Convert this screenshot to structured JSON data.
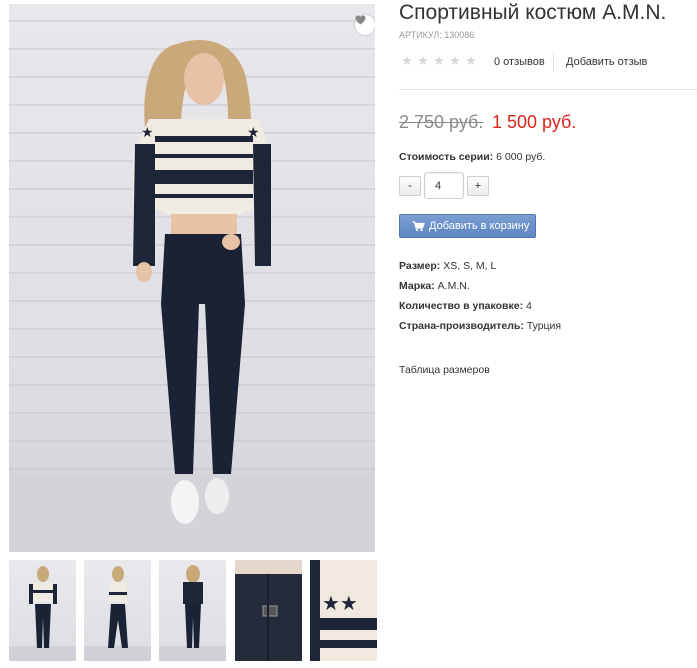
{
  "product": {
    "title": "Спортивный костюм A.M.N.",
    "article": "АРТИКУЛ: 130086",
    "rating_stars": 0,
    "reviews_count": "0 отзывов",
    "add_review": "Добавить отзыв",
    "old_price": "2 750 руб.",
    "new_price": "1 500 руб.",
    "series_cost_label": "Стоимость серии:",
    "series_cost_value": "6 000 руб.",
    "quantity_value": "4",
    "qty_minus": "-",
    "qty_plus": "+",
    "add_to_cart": "Добавить в корзину",
    "properties": [
      {
        "label": "Размер:",
        "value": "XS, S, M, L"
      },
      {
        "label": "Марка:",
        "value": "A.M.N."
      },
      {
        "label": "Количество в упаковке:",
        "value": "4"
      },
      {
        "label": "Страна-производитель:",
        "value": "Турция"
      }
    ],
    "size_table_link": "Таблица размеров"
  },
  "colors": {
    "price_new": "#d9261c",
    "price_old": "#8a8a8a",
    "cart_button": "#6a91c9",
    "star_empty": "#d6d6d6"
  },
  "icons": {
    "favorite": "heart-icon",
    "cart": "shopping-cart-icon",
    "star": "star-icon"
  }
}
